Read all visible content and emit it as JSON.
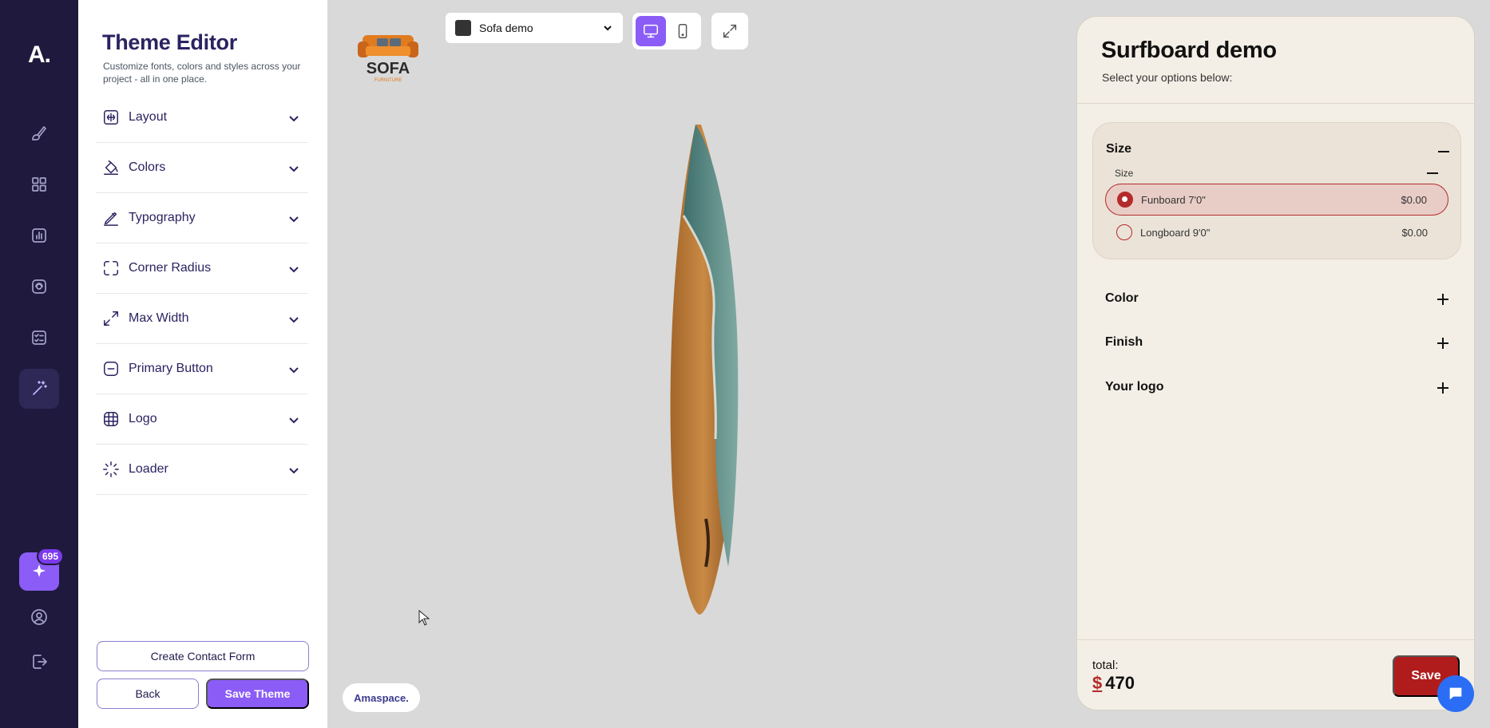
{
  "rail": {
    "logo": "A.",
    "items": [
      {
        "icon": "brush-icon"
      },
      {
        "icon": "grid-icon"
      },
      {
        "icon": "chart-icon"
      },
      {
        "icon": "fingerprint-icon"
      },
      {
        "icon": "checklist-icon"
      },
      {
        "icon": "magic-wand-icon",
        "active": true
      }
    ],
    "badge_count": "695"
  },
  "editor": {
    "title": "Theme Editor",
    "subtitle": "Customize fonts, colors and styles across your project - all in one place.",
    "sections": [
      {
        "label": "Layout",
        "icon": "layout-icon"
      },
      {
        "label": "Colors",
        "icon": "paint-bucket-icon"
      },
      {
        "label": "Typography",
        "icon": "pen-icon"
      },
      {
        "label": "Corner Radius",
        "icon": "corner-radius-icon"
      },
      {
        "label": "Max Width",
        "icon": "resize-icon"
      },
      {
        "label": "Primary Button",
        "icon": "button-icon"
      },
      {
        "label": "Logo",
        "icon": "globe-icon"
      },
      {
        "label": "Loader",
        "icon": "loader-icon"
      }
    ],
    "create_contact_form": "Create Contact Form",
    "back": "Back",
    "save_theme": "Save Theme"
  },
  "canvas": {
    "brand_logo_text": "SOFA",
    "brand_logo_subtext": "FURNITURE",
    "project_select": "Sofa demo",
    "watermark": "Amaspace."
  },
  "configurator": {
    "title": "Surfboard demo",
    "subtitle": "Select your options below:",
    "size_group": {
      "title": "Size",
      "subtitle": "Size",
      "options": [
        {
          "label": "Funboard 7'0\"",
          "price": "$0.00",
          "selected": true
        },
        {
          "label": "Longboard 9'0\"",
          "price": "$0.00",
          "selected": false
        }
      ]
    },
    "collapsed_groups": [
      "Color",
      "Finish",
      "Your logo"
    ],
    "total_label": "total:",
    "currency": "$",
    "total_value": "470",
    "save": "Save"
  },
  "colors": {
    "rail_bg": "#1f1a3d",
    "accent": "#8b5cf6",
    "config_bg": "#f4efe6",
    "brand_red": "#b01c1c",
    "chat_blue": "#2b6ef5"
  }
}
